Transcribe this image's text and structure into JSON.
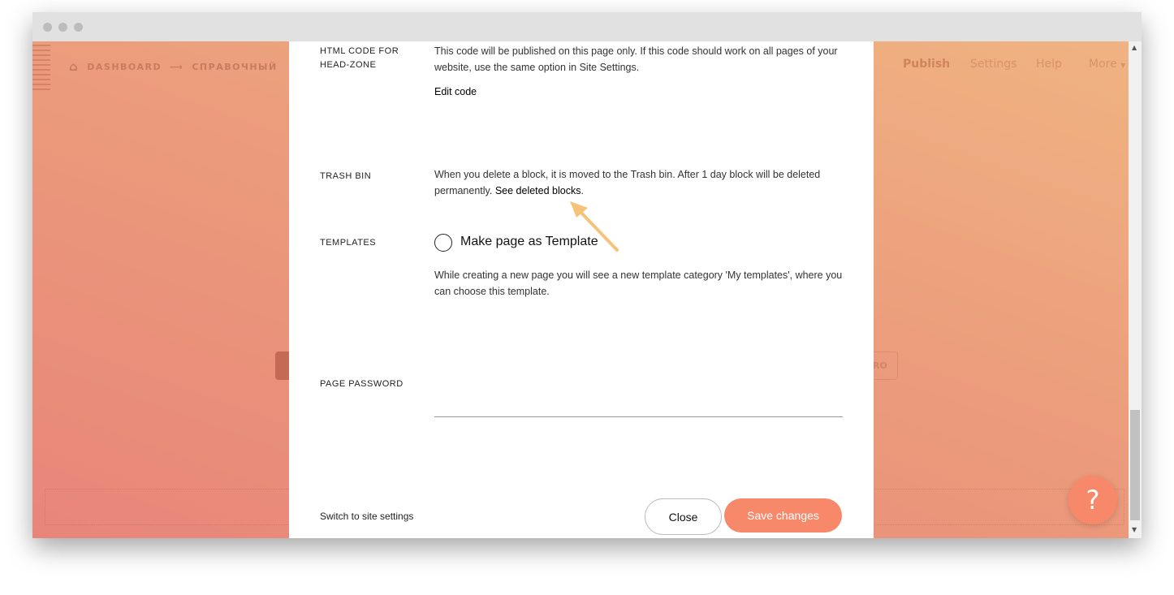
{
  "topbar": {
    "breadcrumb": [
      "DASHBOARD",
      "СПРАВОЧНЫЙ"
    ],
    "nav": [
      "Publish",
      "Settings",
      "Help",
      "More"
    ]
  },
  "background": {
    "pro_label": "RO",
    "help_label": "?"
  },
  "modal": {
    "head_zone": {
      "label": "HTML CODE FOR HEAD-ZONE",
      "text": "This code will be published on this page only. If this code should work on all pages of your website, use the same option in Site Settings.",
      "action": "Edit code"
    },
    "trash": {
      "label": "TRASH BIN",
      "text": "When you delete a block, it is moved to the Trash bin. After 1 day block will be deleted permanently.",
      "link": "See deleted blocks",
      "after": "."
    },
    "templates": {
      "label": "TEMPLATES",
      "checkbox": "Make page as Template",
      "checked": false,
      "text": "While creating a new page you will see a new template category 'My templates', where you can choose this template."
    },
    "password": {
      "label": "PAGE PASSWORD",
      "value": ""
    },
    "footer": {
      "switch": "Switch to site settings",
      "close": "Close",
      "save": "Save changes"
    }
  },
  "colors": {
    "accent": "#f7896a",
    "arrow": "#f7c27a"
  }
}
